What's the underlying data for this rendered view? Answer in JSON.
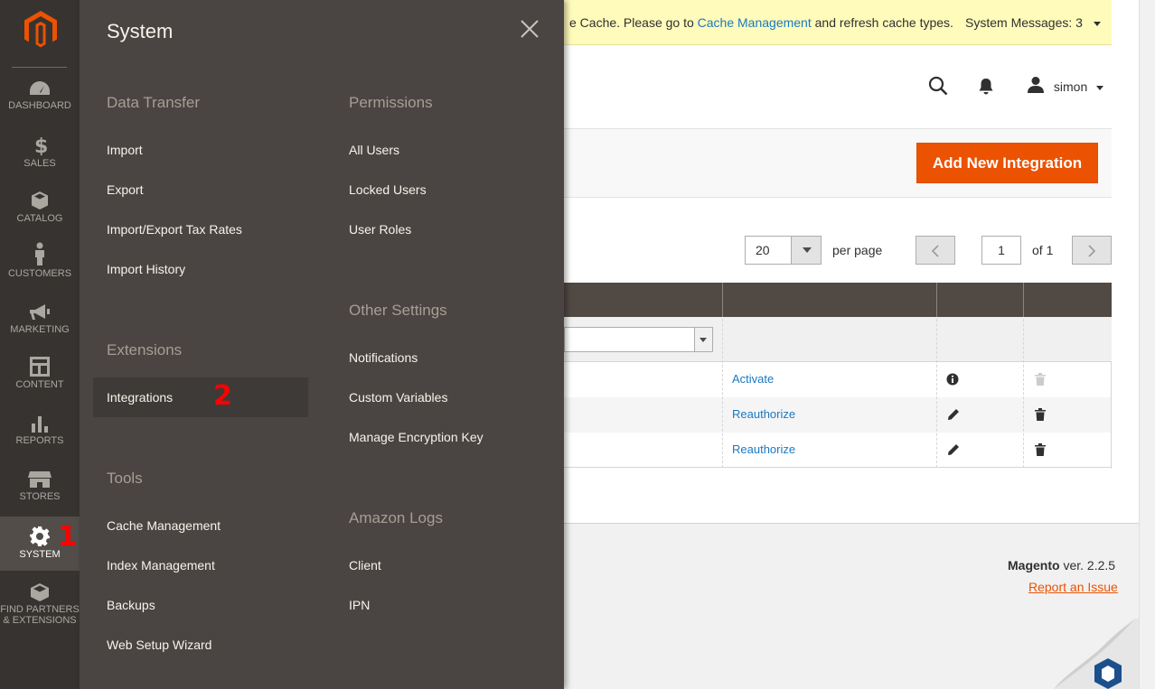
{
  "leftnav": {
    "items": [
      {
        "label": "DASHBOARD",
        "icon": "dashboard-icon"
      },
      {
        "label": "SALES",
        "icon": "dollar-icon"
      },
      {
        "label": "CATALOG",
        "icon": "box-icon"
      },
      {
        "label": "CUSTOMERS",
        "icon": "person-icon"
      },
      {
        "label": "MARKETING",
        "icon": "megaphone-icon"
      },
      {
        "label": "CONTENT",
        "icon": "layout-icon"
      },
      {
        "label": "REPORTS",
        "icon": "bar-chart-icon"
      },
      {
        "label": "STORES",
        "icon": "storefront-icon"
      },
      {
        "label": "SYSTEM",
        "icon": "gear-icon"
      },
      {
        "label_line1": "FIND PARTNERS",
        "label_line2": "& EXTENSIONS",
        "icon": "partners-icon"
      }
    ],
    "active": "SYSTEM"
  },
  "annotations": {
    "marker1": "1",
    "marker2": "2"
  },
  "flyout": {
    "title": "System",
    "data_transfer": {
      "heading": "Data Transfer",
      "links": [
        "Import",
        "Export",
        "Import/Export Tax Rates",
        "Import History"
      ]
    },
    "extensions": {
      "heading": "Extensions",
      "links": [
        "Integrations"
      ]
    },
    "tools": {
      "heading": "Tools",
      "links": [
        "Cache Management",
        "Index Management",
        "Backups",
        "Web Setup Wizard"
      ]
    },
    "permissions": {
      "heading": "Permissions",
      "links": [
        "All Users",
        "Locked Users",
        "User Roles"
      ]
    },
    "other_settings": {
      "heading": "Other Settings",
      "links": [
        "Notifications",
        "Custom Variables",
        "Manage Encryption Key"
      ]
    },
    "amazon_logs": {
      "heading": "Amazon Logs",
      "links": [
        "Client",
        "IPN"
      ]
    }
  },
  "message_bar": {
    "text_before": "e Cache. Please go to ",
    "link": "Cache Management",
    "text_after": " and refresh cache types.",
    "system_messages": "System Messages: 3"
  },
  "header": {
    "username": "simon"
  },
  "actions": {
    "add_button": "Add New Integration"
  },
  "pager": {
    "per_page_value": "20",
    "per_page_label": "per page",
    "page_value": "1",
    "of_label": "of 1"
  },
  "grid": {
    "rows": [
      {
        "action": "Activate",
        "info_icon": "info-icon",
        "trash_icon": "trash-icon-disabled"
      },
      {
        "action": "Reauthorize",
        "info_icon": "pencil-icon",
        "trash_icon": "trash-icon"
      },
      {
        "action": "Reauthorize",
        "info_icon": "pencil-icon",
        "trash_icon": "trash-icon"
      }
    ]
  },
  "footer": {
    "brand": "Magento",
    "version": " ver. 2.2.5",
    "report_link": "Report an Issue"
  },
  "colors": {
    "accent": "#eb5202",
    "nav_bg": "#373330",
    "flyout_bg": "#4a4542",
    "link": "#1979c3"
  }
}
